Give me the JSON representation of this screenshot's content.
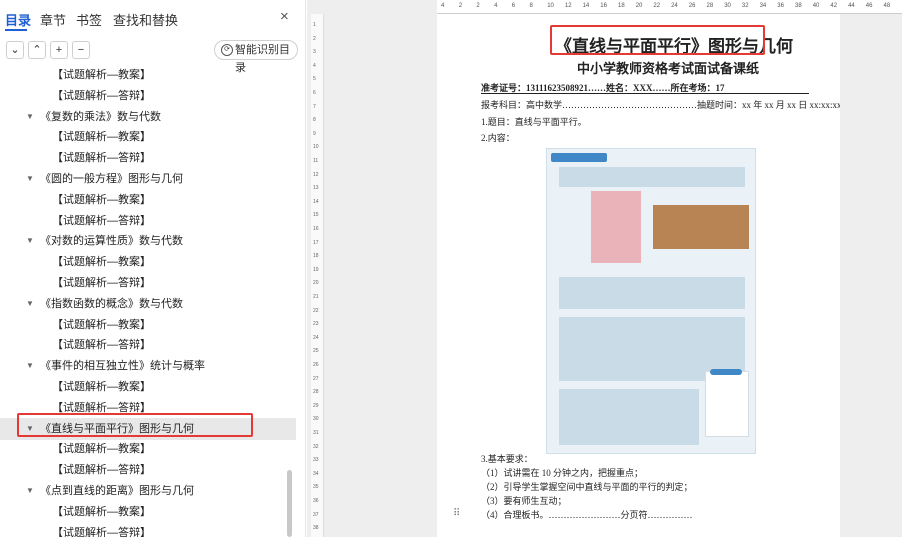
{
  "tabs": [
    {
      "label": "目录"
    },
    {
      "label": "章节"
    },
    {
      "label": "书签"
    },
    {
      "label": "查找和替换"
    }
  ],
  "close_label": "×",
  "tools": {
    "collapse": "⌄",
    "expand": "⌃",
    "add": "+",
    "remove": "−",
    "smart_toc": "智能识别目录"
  },
  "tree": [
    {
      "label": "【试题解析—教案】",
      "level": 2
    },
    {
      "label": "【试题解析—答辩】",
      "level": 2
    },
    {
      "label": "《复数的乘法》数与代数",
      "level": 1
    },
    {
      "label": "【试题解析—教案】",
      "level": 2
    },
    {
      "label": "【试题解析—答辩】",
      "level": 2
    },
    {
      "label": "《圆的一般方程》图形与几何",
      "level": 1
    },
    {
      "label": "【试题解析—教案】",
      "level": 2
    },
    {
      "label": "【试题解析—答辩】",
      "level": 2
    },
    {
      "label": "《对数的运算性质》数与代数",
      "level": 1
    },
    {
      "label": "【试题解析—教案】",
      "level": 2
    },
    {
      "label": "【试题解析—答辩】",
      "level": 2
    },
    {
      "label": "《指数函数的概念》数与代数",
      "level": 1
    },
    {
      "label": "【试题解析—教案】",
      "level": 2
    },
    {
      "label": "【试题解析—答辩】",
      "level": 2
    },
    {
      "label": "《事件的相互独立性》统计与概率",
      "level": 1
    },
    {
      "label": "【试题解析—教案】",
      "level": 2
    },
    {
      "label": "【试题解析—答辩】",
      "level": 2
    },
    {
      "label": "《直线与平面平行》图形与几何",
      "level": 1,
      "selected": true
    },
    {
      "label": "【试题解析—教案】",
      "level": 2
    },
    {
      "label": "【试题解析—答辩】",
      "level": 2
    },
    {
      "label": "《点到直线的距离》图形与几何",
      "level": 1
    },
    {
      "label": "【试题解析—教案】",
      "level": 2
    },
    {
      "label": "【试题解析—答辩】",
      "level": 2
    }
  ],
  "ruler": [
    "4",
    "2",
    "2",
    "4",
    "6",
    "8",
    "10",
    "12",
    "14",
    "16",
    "18",
    "20",
    "22",
    "24",
    "26",
    "28",
    "30",
    "32",
    "34",
    "36",
    "38",
    "40",
    "42",
    "44",
    "46",
    "48"
  ],
  "vruler": [
    "1",
    "2",
    "3",
    "4",
    "5",
    "6",
    "7",
    "8",
    "9",
    "10",
    "11",
    "12",
    "13",
    "14",
    "15",
    "16",
    "17",
    "18",
    "19",
    "20",
    "21",
    "22",
    "23",
    "24",
    "25",
    "26",
    "27",
    "28",
    "29",
    "30",
    "31",
    "32",
    "33",
    "34",
    "35",
    "36",
    "37",
    "38"
  ],
  "doc": {
    "title": "《直线与平面平行》图形与几何",
    "subtitle": "中小学教师资格考试面试备课纸",
    "meta1": "准考证号：13111623508921……姓名：XXX……所在考场：17",
    "meta2": "报考科目：高中数学………………………………………抽题时间：xx 年 xx 月 xx 日 xx:xx:xx",
    "l1": "1.题目：直线与平面平行。",
    "l2": "2.内容：",
    "l3": "3.基本要求：",
    "l4": "（1）试讲需在 10 分钟之内，把握重点；",
    "l5": "（2）引导学生掌握空间中直线与平面的平行的判定；",
    "l6": "（3）要有师生互动；",
    "l7": "（4）合理板书。……………………分页符……………"
  },
  "colors": {
    "accent": "#1f5fd6",
    "highlight": "#e53935",
    "figure": "#3f87c7"
  }
}
